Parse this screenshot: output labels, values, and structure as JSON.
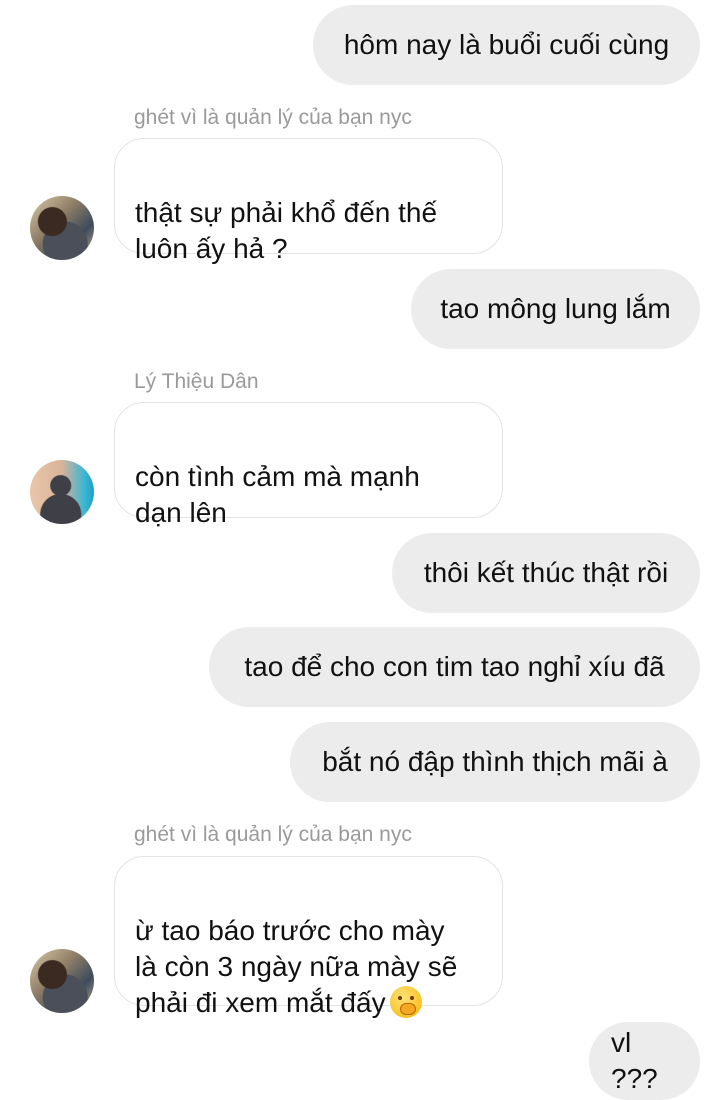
{
  "conversation": {
    "messages": [
      {
        "direction": "out",
        "text": "hôm nay là buổi cuối cùng"
      },
      {
        "direction": "in",
        "sender": "ghét vì là quản lý của bạn nyc",
        "avatar": "avatar-photo",
        "text": "thật sự phải khổ đến thế\nluôn ấy hả ?"
      },
      {
        "direction": "out",
        "text": "tao mông lung lắm"
      },
      {
        "direction": "in",
        "sender": "Lý Thiệu Dân",
        "avatar": "avatar-photo",
        "text": "còn tình cảm mà mạnh\ndạn lên"
      },
      {
        "direction": "out",
        "text": "thôi kết thúc thật rồi"
      },
      {
        "direction": "out",
        "text": "tao để cho con tim tao nghỉ xíu đã"
      },
      {
        "direction": "out",
        "text": "bắt nó đập thình thịch mãi à"
      },
      {
        "direction": "in",
        "sender": "ghét vì là quản lý của bạn nyc",
        "avatar": "avatar-photo",
        "text": "ừ tao báo trước cho mày\nlà còn 3 ngày nữa mày sẽ\nphải đi xem mắt đấy",
        "emoji": "hand-over-mouth-emoji"
      },
      {
        "direction": "out",
        "text": "vl ???"
      }
    ]
  },
  "colors": {
    "outgoing_bubble": "#ececec",
    "incoming_bubble": "#ffffff",
    "incoming_border": "#e3e3e3",
    "sender_name": "#9a9a9a",
    "text": "#111111"
  }
}
